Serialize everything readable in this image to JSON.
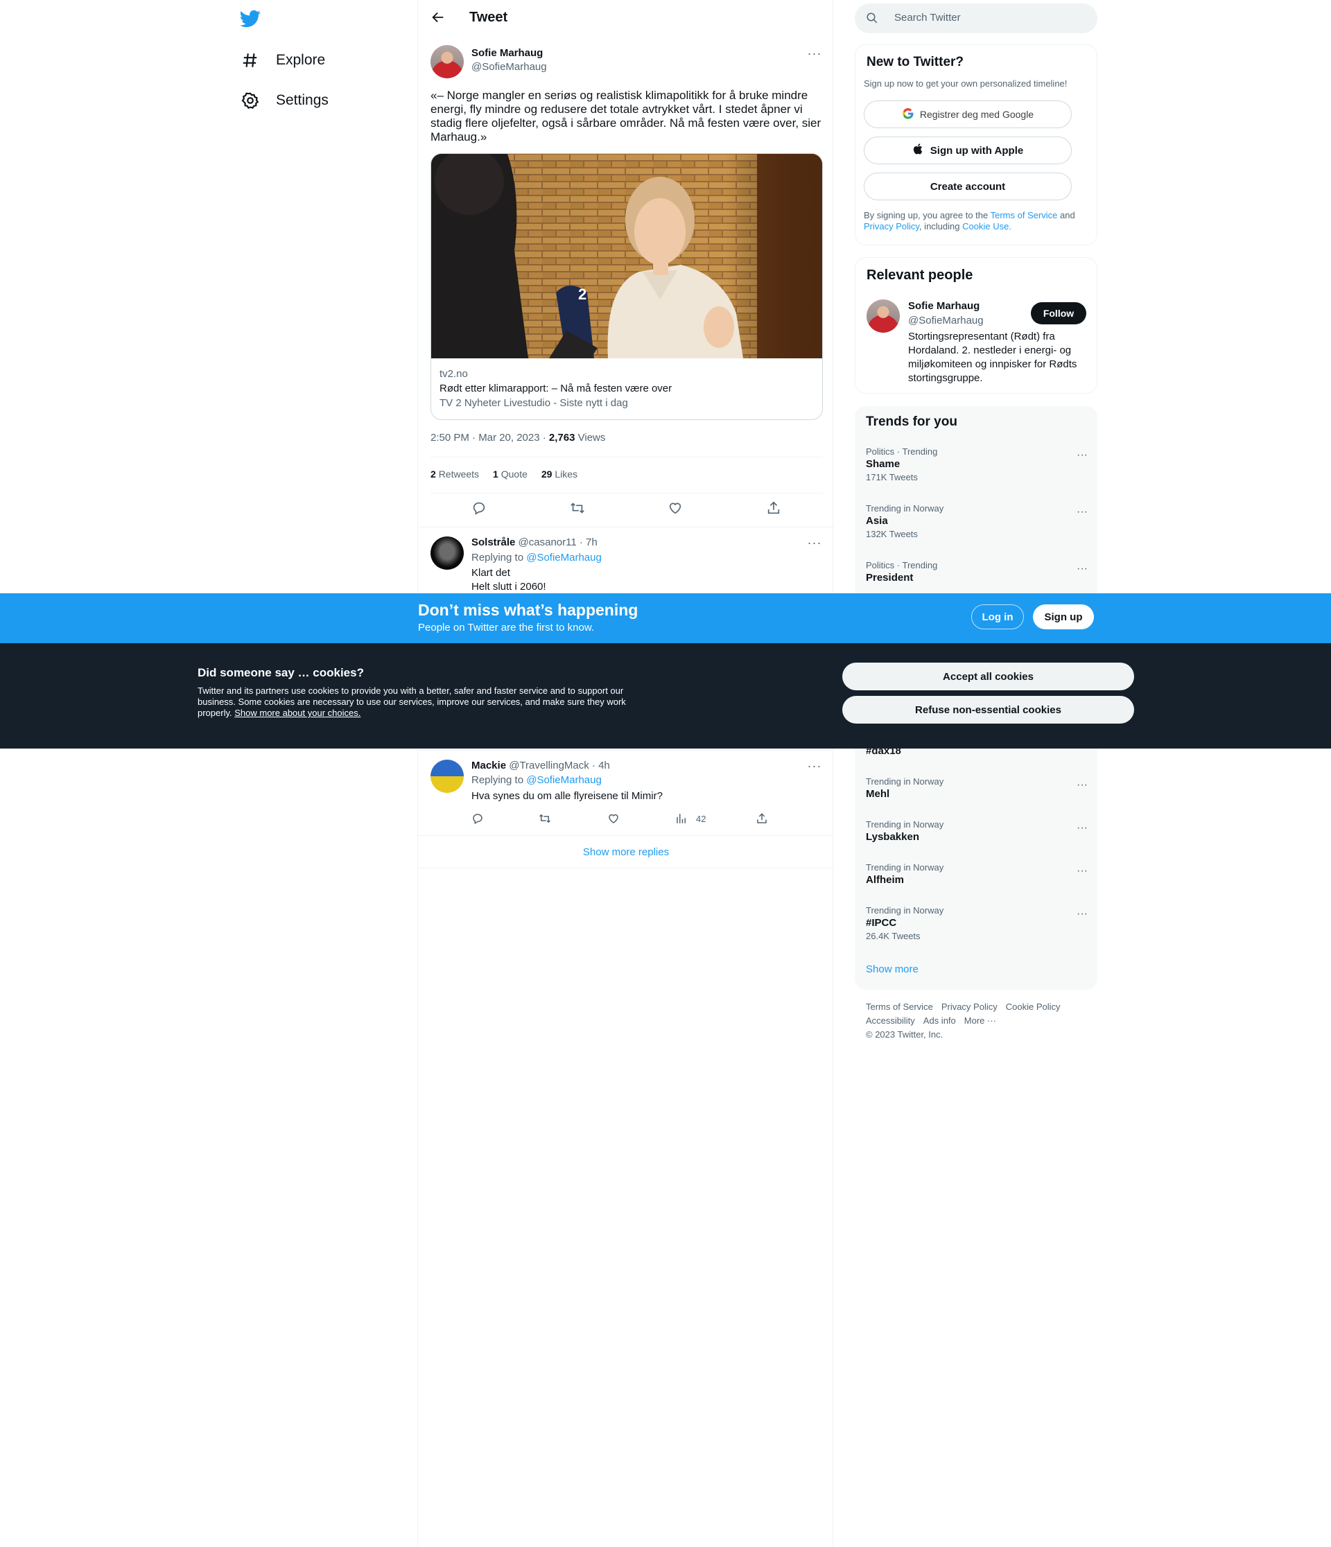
{
  "nav": {
    "explore": "Explore",
    "settings": "Settings"
  },
  "header": {
    "title": "Tweet"
  },
  "tweet": {
    "author_name": "Sofie Marhaug",
    "author_handle": "@SofieMarhaug",
    "text": "«– Norge mangler en seriøs og realistisk klimapolitikk for å bruke mindre energi, fly mindre og redusere det totale avtrykket vårt. I stedet åpner vi stadig flere oljefelter, også i sårbare områder. Nå må festen være over, sier Marhaug.»",
    "card": {
      "domain": "tv2.no",
      "title": "Rødt etter klimarapport: – Nå må festen være over",
      "description": "TV 2 Nyheter Livestudio - Siste nytt i dag"
    },
    "timestamp": "2:50 PM · Mar 20, 2023 · ",
    "views_count": "2,763",
    "views_label": "Views",
    "retweets_count": "2",
    "retweets_label": "Retweets",
    "quotes_count": "1",
    "quotes_label": "Quote",
    "likes_count": "29",
    "likes_label": "Likes"
  },
  "replies": [
    {
      "name": "Solstråle",
      "handle_time": "@casanor11 · 7h",
      "replying_prefix": "Replying to ",
      "replying_to": "@SofieMarhaug",
      "line1": "Klart det",
      "line2": "Helt slutt i 2060!"
    },
    {
      "name": "Mackie",
      "handle_time": "@TravellingMack · 4h",
      "replying_prefix": "Replying to ",
      "replying_to": "@SofieMarhaug",
      "line1": "Hva synes du om alle flyreisene til Mimir?",
      "views": "42"
    }
  ],
  "show_more_replies": "Show more replies",
  "search": {
    "placeholder": "Search Twitter"
  },
  "new_to_twitter": {
    "title": "New to Twitter?",
    "subtitle": "Sign up now to get your own personalized timeline!",
    "google": "Registrer deg med Google",
    "apple": "Sign up with Apple",
    "create": "Create account",
    "terms_prefix": "By signing up, you agree to the ",
    "terms_link": "Terms of Service",
    "terms_and": " and ",
    "privacy_link": "Privacy Policy",
    "terms_including": ", including ",
    "cookie_link": "Cookie Use."
  },
  "relevant_people": {
    "title": "Relevant people",
    "name": "Sofie Marhaug",
    "handle": "@SofieMarhaug",
    "follow": "Follow",
    "bio": "Stortingsrepresentant (Rødt) fra Hordaland. 2. nestleder i energi- og miljøkomiteen og innpisker for Rødts stortingsgruppe."
  },
  "trends": {
    "title": "Trends for you",
    "items": [
      {
        "context": "Politics · Trending",
        "name": "Shame",
        "count": "171K Tweets"
      },
      {
        "context": "Trending in Norway",
        "name": "Asia",
        "count": "132K Tweets"
      },
      {
        "context": "Politics · Trending",
        "name": "President",
        "count": ""
      },
      {
        "context": "",
        "name": "#dax18",
        "count": ""
      },
      {
        "context": "Trending in Norway",
        "name": "Mehl",
        "count": ""
      },
      {
        "context": "Trending in Norway",
        "name": "Lysbakken",
        "count": ""
      },
      {
        "context": "Trending in Norway",
        "name": "Alfheim",
        "count": ""
      },
      {
        "context": "Trending in Norway",
        "name": "#IPCC",
        "count": "26.4K Tweets"
      }
    ],
    "show_more": "Show more"
  },
  "footer": {
    "terms": "Terms of Service",
    "privacy": "Privacy Policy",
    "cookie": "Cookie Policy",
    "accessibility": "Accessibility",
    "ads": "Ads info",
    "more": "More ···",
    "copyright": "© 2023 Twitter, Inc."
  },
  "banner": {
    "title": "Don’t miss what’s happening",
    "subtitle": "People on Twitter are the first to know.",
    "login": "Log in",
    "signup": "Sign up"
  },
  "cookie": {
    "title": "Did someone say … cookies?",
    "text": "Twitter and its partners use cookies to provide you with a better, safer and faster service and to support our business. Some cookies are necessary to use our services, improve our services, and make sure they work properly. ",
    "link": "Show more about your choices.",
    "accept": "Accept all cookies",
    "refuse": "Refuse non-essential cookies"
  },
  "colors": {
    "accent": "#1d9bf0",
    "text": "#0f1419",
    "muted": "#536471",
    "cookie_bg": "#15202b"
  }
}
